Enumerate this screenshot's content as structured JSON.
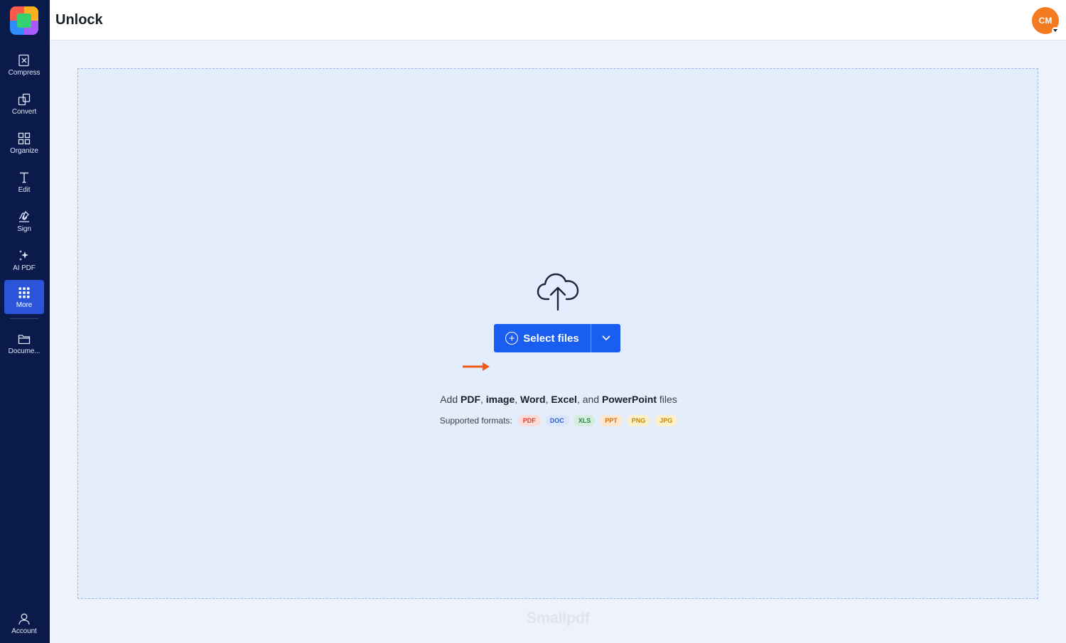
{
  "header": {
    "title": "Unlock",
    "avatar_initials": "CM"
  },
  "sidebar": {
    "items": [
      {
        "label": "Compress",
        "icon": "compress-icon"
      },
      {
        "label": "Convert",
        "icon": "convert-icon"
      },
      {
        "label": "Organize",
        "icon": "organize-icon"
      },
      {
        "label": "Edit",
        "icon": "edit-text-icon"
      },
      {
        "label": "Sign",
        "icon": "signature-icon"
      },
      {
        "label": "AI PDF",
        "icon": "sparkles-icon"
      },
      {
        "label": "More",
        "icon": "grid-dots-icon",
        "active": true
      },
      {
        "label": "Docume...",
        "icon": "folder-icon"
      },
      {
        "label": "Account",
        "icon": "user-icon"
      }
    ]
  },
  "dropzone": {
    "select_label": "Select files",
    "add_text": {
      "p1": "Add ",
      "pdf": "PDF",
      "c1": ", ",
      "image": "image",
      "c2": ", ",
      "word": "Word",
      "c3": ", ",
      "excel": "Excel",
      "c4": ", and ",
      "ppt": "PowerPoint",
      "p2": " files"
    },
    "supported_label": "Supported formats:",
    "formats": [
      {
        "label": "PDF",
        "bg": "#fcdcd8",
        "fg": "#d9412f"
      },
      {
        "label": "DOC",
        "bg": "#dce6fb",
        "fg": "#2a5bd7"
      },
      {
        "label": "XLS",
        "bg": "#d6ecdd",
        "fg": "#1f8a49"
      },
      {
        "label": "PPT",
        "bg": "#fde8cf",
        "fg": "#d07118"
      },
      {
        "label": "PNG",
        "bg": "#fcefcc",
        "fg": "#c58a0d"
      },
      {
        "label": "JPG",
        "bg": "#fcefcc",
        "fg": "#c58a0d"
      }
    ]
  },
  "watermark": "Smallpdf",
  "colors": {
    "sidebar_bg": "#0a1a4b",
    "accent": "#1a5ef1",
    "avatar": "#f47a1f",
    "arrow": "#f05a1a"
  }
}
